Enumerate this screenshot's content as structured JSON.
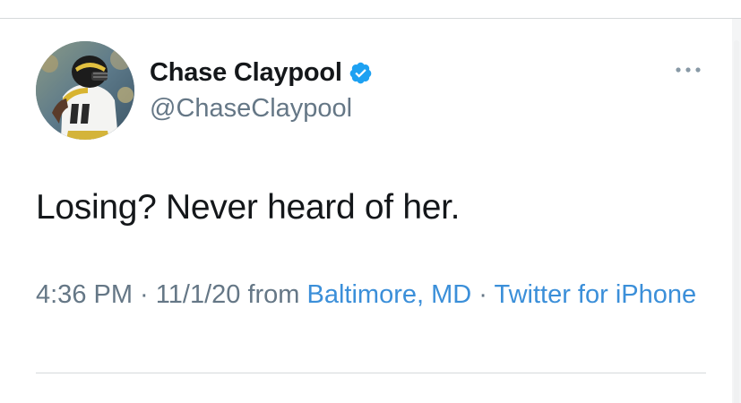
{
  "author": {
    "display_name": "Chase Claypool",
    "handle": "@ChaseClaypool",
    "verified": true,
    "avatar_icon": "player-avatar"
  },
  "tweet": {
    "text": "Losing? Never heard of her."
  },
  "meta": {
    "time": "4:36 PM",
    "separator1": " · ",
    "date": "11/1/20",
    "from_label": " from ",
    "location": "Baltimore, MD",
    "separator2": " · ",
    "source": "Twitter for iPhone"
  },
  "colors": {
    "link": "#3b8fd9",
    "verified": "#1da1f2",
    "text": "#14171a",
    "muted": "#657786"
  },
  "icons": {
    "more": "more-dots-icon",
    "verified": "verified-badge-icon"
  }
}
